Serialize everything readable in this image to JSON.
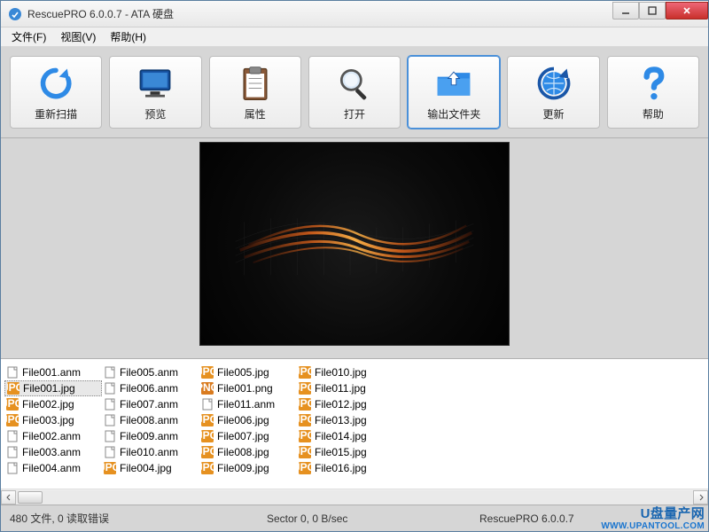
{
  "window": {
    "title": "RescuePRO 6.0.0.7 - ATA 硬盘"
  },
  "menubar": [
    {
      "label": "文件(F)"
    },
    {
      "label": "视图(V)"
    },
    {
      "label": "帮助(H)"
    }
  ],
  "toolbar": [
    {
      "id": "rescan",
      "label": "重新扫描",
      "icon": "rescan-icon"
    },
    {
      "id": "preview",
      "label": "预览",
      "icon": "monitor-icon"
    },
    {
      "id": "properties",
      "label": "属性",
      "icon": "clipboard-icon"
    },
    {
      "id": "open",
      "label": "打开",
      "icon": "magnifier-icon"
    },
    {
      "id": "output",
      "label": "输出文件夹",
      "icon": "folder-up-icon",
      "active": true
    },
    {
      "id": "update",
      "label": "更新",
      "icon": "globe-refresh-icon"
    },
    {
      "id": "help",
      "label": "帮助",
      "icon": "question-icon"
    }
  ],
  "preview_file": "File001.jpg",
  "files": {
    "columns": [
      [
        "File001.anm",
        "File001.jpg",
        "File002.jpg",
        "File003.jpg"
      ],
      [
        "File002.anm",
        "File003.anm",
        "File004.anm",
        "File005.anm"
      ],
      [
        "File006.anm",
        "File007.anm",
        "File008.anm",
        "File009.anm"
      ],
      [
        "File010.anm",
        "File004.jpg",
        "File005.jpg",
        "File001.png"
      ],
      [
        "File011.anm",
        "File006.jpg",
        "File007.jpg",
        "File008.jpg"
      ],
      [
        "File009.jpg",
        "File010.jpg",
        "File011.jpg",
        "File012.jpg"
      ],
      [
        "File013.jpg",
        "File014.jpg",
        "File015.jpg",
        "File016.jpg"
      ]
    ],
    "selected": "File001.jpg",
    "ext_icons": {
      "anm": "anm",
      "jpg": "jpg",
      "png": "png"
    }
  },
  "statusbar": {
    "left": "480 文件, 0 读取错误",
    "mid": "Sector 0, 0 B/sec",
    "right": "RescuePRO 6.0.0.7"
  },
  "watermark": {
    "line1": "U盘量产网",
    "line2": "WWW.UPANTOOL.COM"
  }
}
